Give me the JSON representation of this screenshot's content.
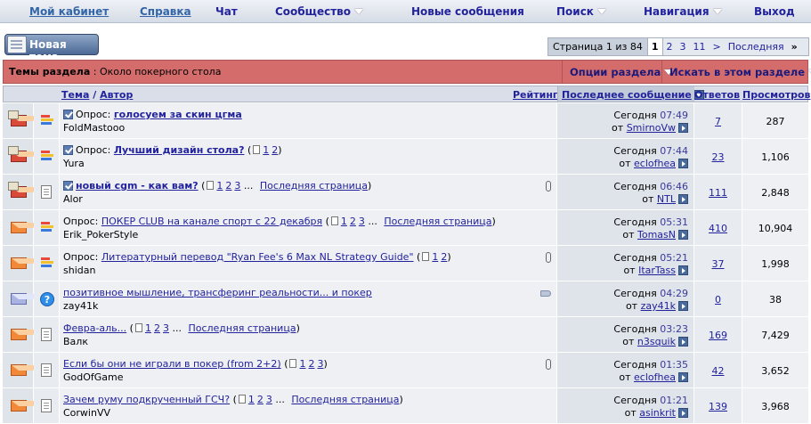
{
  "nav": {
    "my_cabinet": "Мой кабинет",
    "help": "Справка",
    "chat": "Чат",
    "community": "Сообщество",
    "new_posts": "Новые сообщения",
    "search": "Поиск",
    "navigation": "Навигация",
    "logout": "Выход"
  },
  "new_thread_label": "Новая тема",
  "pager": {
    "info": "Страница 1 из 84",
    "current": "1",
    "pages": [
      "2",
      "3",
      "11"
    ],
    "next": ">",
    "last": "Последняя",
    "last_glyph": "»"
  },
  "section": {
    "label": "Темы раздела",
    "sep": " : ",
    "name": "Около покерного стола",
    "options": "Опции раздела",
    "search_in": "Искать в этом разделе"
  },
  "columns": {
    "topic": "Тема",
    "slash": " / ",
    "author": "Автор",
    "rating": "Рейтинг",
    "last_post": "Последнее сообщение",
    "replies": "Ответов",
    "views": "Просмотров"
  },
  "common": {
    "poll": "Опрос:",
    "last_page": "Последняя страница",
    "by": "от"
  },
  "threads": [
    {
      "title": "голосуем за скин цгма",
      "author": "FoldMastooo",
      "date": "Сегодня",
      "time": "07:49",
      "last_user": "SmirnoVw",
      "replies": "7",
      "views": "287"
    },
    {
      "title": "Лучший дизайн стола?",
      "author": "Yura",
      "date": "Сегодня",
      "time": "07:44",
      "last_user": "eclofhea",
      "replies": "23",
      "views": "1,106",
      "pages": [
        "1",
        "2"
      ]
    },
    {
      "title": "новый cgm - как вам?",
      "author": "Alor",
      "date": "Сегодня",
      "time": "06:46",
      "last_user": "NTL",
      "replies": "111",
      "views": "2,848",
      "pages": [
        "1",
        "2",
        "3"
      ]
    },
    {
      "title": "ПОКЕР CLUB на канале спорт с 22 декабря",
      "author": "Erik_PokerStyle",
      "date": "Сегодня",
      "time": "05:31",
      "last_user": "TomasN",
      "replies": "410",
      "views": "10,904",
      "pages": [
        "1",
        "2",
        "3"
      ]
    },
    {
      "title": "Литературный перевод \"Ryan Fee's 6 Max NL Strategy Guide\"",
      "author": "shidan",
      "date": "Сегодня",
      "time": "05:21",
      "last_user": "ItarTass",
      "replies": "37",
      "views": "1,998",
      "pages": [
        "1",
        "2"
      ]
    },
    {
      "title": "позитивное мышление, трансферинг реальности... и покер",
      "author": "zay41k",
      "date": "Сегодня",
      "time": "04:29",
      "last_user": "zay41k",
      "replies": "0",
      "views": "38"
    },
    {
      "title": "Февра-аль...",
      "author": "Валк",
      "date": "Сегодня",
      "time": "03:23",
      "last_user": "n3squik",
      "replies": "169",
      "views": "7,429",
      "pages": [
        "1",
        "2",
        "3"
      ]
    },
    {
      "title": "Если бы они не играли в покер (from 2+2)",
      "author": "GodOfGame",
      "date": "Сегодня",
      "time": "01:35",
      "last_user": "eclofhea",
      "replies": "42",
      "views": "3,652",
      "pages": [
        "1",
        "2",
        "3"
      ]
    },
    {
      "title": "Зачем руму подкрученный ГСЧ?",
      "author": "CorwinVV",
      "date": "Сегодня",
      "time": "01:21",
      "last_user": "asinkrit",
      "replies": "139",
      "views": "3,968",
      "pages": [
        "1",
        "2",
        "3"
      ]
    }
  ]
}
